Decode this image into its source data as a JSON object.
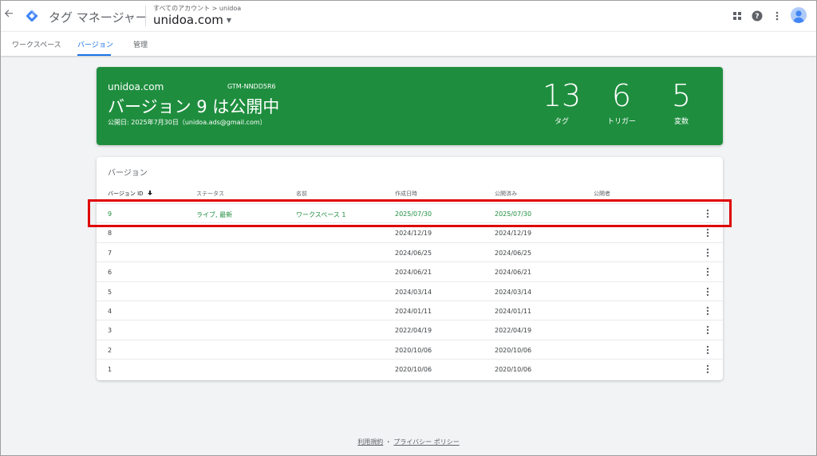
{
  "header": {
    "product_name": "タグ マネージャー",
    "breadcrumb_all": "すべてのアカウント",
    "breadcrumb_sep": ">",
    "breadcrumb_account": "unidoa",
    "container_name": "unidoa.com"
  },
  "tabs": [
    {
      "label": "ワークスペース",
      "active": false
    },
    {
      "label": "バージョン",
      "active": true
    },
    {
      "label": "管理",
      "active": false
    }
  ],
  "live_version": {
    "container": "unidoa.com",
    "gtm_id": "GTM-NNDD5R6",
    "title": "バージョン 9 は公開中",
    "published": "公開日: 2025年7月30日（unidoa.ads@gmail.com）",
    "stats": [
      {
        "value": "13",
        "label": "タグ"
      },
      {
        "value": "6",
        "label": "トリガー"
      },
      {
        "value": "5",
        "label": "変数"
      }
    ]
  },
  "versions_table": {
    "title": "バージョン",
    "columns": [
      "バージョン ID",
      "ステータス",
      "名前",
      "作成日時",
      "公開済み",
      "公開者"
    ],
    "sort_icon": "arrow-down-icon",
    "rows": [
      {
        "id": "9",
        "status": "ライブ, 最新",
        "name": "ワークスペース 1",
        "created": "2025/07/30",
        "published": "2025/07/30",
        "publisher": ""
      },
      {
        "id": "8",
        "status": "",
        "name": "",
        "created": "2024/12/19",
        "published": "2024/12/19",
        "publisher": ""
      },
      {
        "id": "7",
        "status": "",
        "name": "",
        "created": "2024/06/25",
        "published": "2024/06/25",
        "publisher": ""
      },
      {
        "id": "6",
        "status": "",
        "name": "",
        "created": "2024/06/21",
        "published": "2024/06/21",
        "publisher": ""
      },
      {
        "id": "5",
        "status": "",
        "name": "",
        "created": "2024/03/14",
        "published": "2024/03/14",
        "publisher": ""
      },
      {
        "id": "4",
        "status": "",
        "name": "",
        "created": "2024/01/11",
        "published": "2024/01/11",
        "publisher": ""
      },
      {
        "id": "3",
        "status": "",
        "name": "",
        "created": "2022/04/19",
        "published": "2022/04/19",
        "publisher": ""
      },
      {
        "id": "2",
        "status": "",
        "name": "",
        "created": "2020/10/06",
        "published": "2020/10/06",
        "publisher": ""
      },
      {
        "id": "1",
        "status": "",
        "name": "",
        "created": "2020/10/06",
        "published": "2020/10/06",
        "publisher": ""
      }
    ]
  },
  "footer": {
    "terms": "利用規約",
    "separator": "・",
    "privacy": "プライバシー ポリシー"
  },
  "colors": {
    "accent": "#1a73e8",
    "live_green": "#1e8e3e",
    "highlight_red": "#e00000"
  }
}
